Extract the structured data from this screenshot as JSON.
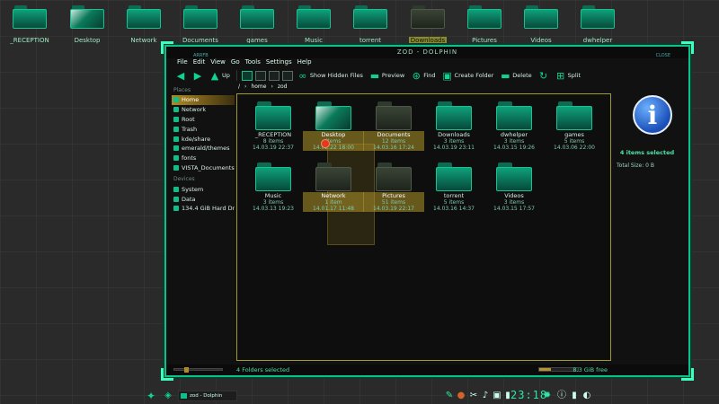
{
  "desktop": {
    "icons": [
      {
        "label": "_RECEPTION"
      },
      {
        "label": "Desktop"
      },
      {
        "label": "Network"
      },
      {
        "label": "Documents"
      },
      {
        "label": "games"
      },
      {
        "label": "Music"
      },
      {
        "label": "torrent"
      },
      {
        "label": "Downloads"
      },
      {
        "label": "Pictures"
      },
      {
        "label": "Videos"
      },
      {
        "label": "dwhelper"
      }
    ]
  },
  "window": {
    "title": "ZOD - DOLPHIN",
    "left_tag": "ARRFB",
    "right_tag": "CLOSE",
    "menu": [
      "File",
      "Edit",
      "View",
      "Go",
      "Tools",
      "Settings",
      "Help"
    ],
    "toolbar": {
      "up": "Up",
      "show_hidden": "Show Hidden Files",
      "preview": "Preview",
      "find": "Find",
      "create_folder": "Create Folder",
      "delete": "Delete",
      "split": "Split"
    },
    "breadcrumb": [
      "/",
      "home",
      "zod"
    ],
    "sidebar": {
      "places_heading": "Places",
      "places": [
        "Home",
        "Network",
        "Root",
        "Trash",
        "kde/share",
        "emerald/themes",
        "fonts",
        "VISTA_Documents"
      ],
      "devices_heading": "Devices",
      "devices": [
        "System",
        "Data",
        "134.4 GiB Hard Dr"
      ]
    },
    "items": [
      {
        "name": "_RECEPTION",
        "count": "8 items",
        "date": "14.03.19 22:37"
      },
      {
        "name": "Desktop",
        "count": "items",
        "date": "14.02.22 18:00"
      },
      {
        "name": "Documents",
        "count": "12 items",
        "date": "14.03.16 17:24"
      },
      {
        "name": "Downloads",
        "count": "3 items",
        "date": "14.03.19 23:11"
      },
      {
        "name": "dwhelper",
        "count": "3 items",
        "date": "14.03.15 19:26"
      },
      {
        "name": "games",
        "count": "5 items",
        "date": "14.03.06 22:00"
      },
      {
        "name": "Music",
        "count": "3 items",
        "date": "14.03.13 19:23"
      },
      {
        "name": "Network",
        "count": "1 item",
        "date": "14.01.17 11:48"
      },
      {
        "name": "Pictures",
        "count": "51 items",
        "date": "14.03.19 22:17"
      },
      {
        "name": "torrent",
        "count": "5 items",
        "date": "14.03.16 14:37"
      },
      {
        "name": "Videos",
        "count": "3 items",
        "date": "14.03.15 17:57"
      }
    ],
    "info": {
      "title": "4 items selected",
      "total_size": "Total Size:  0 B"
    },
    "status": {
      "text": "4 Folders selected",
      "free": "8.3 GiB free",
      "free_fraction": 0.3,
      "zoom_fraction": 0.2
    }
  },
  "taskbar": {
    "task": "zod - Dolphin",
    "clock": "23:18"
  },
  "colors": {
    "accent": "#0fbf8a",
    "selection": "#b08a22"
  }
}
